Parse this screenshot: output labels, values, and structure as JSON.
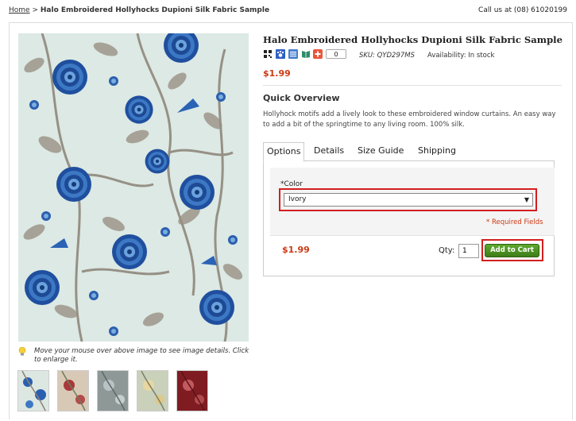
{
  "breadcrumb": {
    "home": "Home",
    "separator": ">",
    "current": "Halo Embroidered Hollyhocks Dupioni Silk Fabric Sample"
  },
  "header": {
    "call_us": "Call us at (08) 61020199"
  },
  "product": {
    "title": "Halo Embroidered Hollyhocks Dupioni Silk Fabric Sample",
    "sku": "SKU: QYD297MS",
    "availability": "Availability: In stock",
    "price": "$1.99",
    "share_count": "0",
    "share_icons": [
      "qr-code-icon",
      "paw-icon",
      "list-icon",
      "book-icon",
      "plus-share-icon"
    ]
  },
  "overview": {
    "title": "Quick Overview",
    "text": "Hollyhock motifs add a lively look to these embroidered window curtains. An easy way to add a bit of the springtime to any living room. 100% silk."
  },
  "tabs": [
    "Options",
    "Details",
    "Size Guide",
    "Shipping"
  ],
  "options": {
    "color_label": "Color",
    "required_mark": "*",
    "color_value": "Ivory",
    "required_fields": "* Required Fields",
    "price": "$1.99",
    "qty_label": "Qty:",
    "qty_value": "1",
    "add_to_cart": "Add to Cart"
  },
  "image": {
    "hint": "Move your mouse over above image to see image details. Click to enlarge it.",
    "thumbnail_colors": [
      "#dde7e2",
      "#d8c9b6",
      "#8d9897",
      "#c9d1bb",
      "#7f1c22"
    ]
  },
  "colors": {
    "accent_red": "#cc3a14",
    "highlight": "#d21f1f",
    "button_green": "#4a8e23"
  }
}
